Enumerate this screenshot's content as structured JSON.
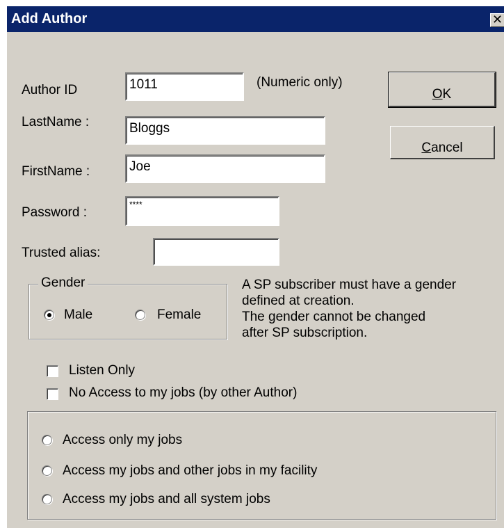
{
  "window": {
    "title": "Add Author",
    "close_glyph": "✕"
  },
  "fields": {
    "author_id": {
      "label": "Author ID",
      "value": "1011",
      "hint": "(Numeric only)"
    },
    "last_name": {
      "label": "LastName :",
      "value": "Bloggs"
    },
    "first_name": {
      "label": "FirstName :",
      "value": "Joe"
    },
    "password": {
      "label": "Password :",
      "value": "****"
    },
    "trusted_alias": {
      "label": "Trusted alias:",
      "value": ""
    }
  },
  "buttons": {
    "ok": {
      "mnemonic": "O",
      "rest": "K"
    },
    "cancel": {
      "mnemonic": "C",
      "rest": "ancel"
    }
  },
  "gender": {
    "legend": "Gender",
    "options": [
      "Male",
      "Female"
    ],
    "selected": "Male",
    "note_lines": [
      "A SP subscriber must have a gender",
      "defined at creation.",
      "The gender cannot be changed",
      "after SP subscription."
    ]
  },
  "checkboxes": {
    "listen_only": {
      "label": "Listen Only",
      "checked": false
    },
    "no_access": {
      "label": "No Access to my jobs (by other Author)",
      "checked": false
    }
  },
  "access": {
    "options": [
      "Access only my jobs",
      "Access my jobs and other jobs in my facility",
      "Access my jobs and all system jobs"
    ],
    "selected": null
  },
  "colors": {
    "titlebar": "#0a246a",
    "face": "#d4d0c8"
  }
}
